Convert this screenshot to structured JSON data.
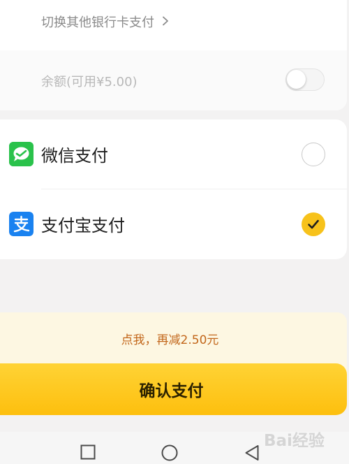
{
  "bank_card": {
    "switch_label": "切换其他银行卡支付"
  },
  "balance": {
    "label": "余额(可用¥5.00)",
    "enabled": false
  },
  "payment_methods": [
    {
      "id": "wechat",
      "label": "微信支付",
      "icon": "wechat-pay-icon",
      "selected": false
    },
    {
      "id": "alipay",
      "label": "支付宝支付",
      "icon": "alipay-icon",
      "selected": true
    }
  ],
  "promo": {
    "text": "点我，再减2.50元"
  },
  "confirm": {
    "label": "确认支付"
  },
  "navigation": {
    "buttons": [
      "recent-apps-icon",
      "home-icon",
      "back-icon"
    ]
  },
  "watermark": {
    "text": "Bai经验"
  },
  "colors": {
    "accent": "#f7c21b",
    "button": "#fdc514",
    "wechat_green": "#2ac24b",
    "alipay_blue": "#1a82f0",
    "promo_text": "#c2661a"
  }
}
